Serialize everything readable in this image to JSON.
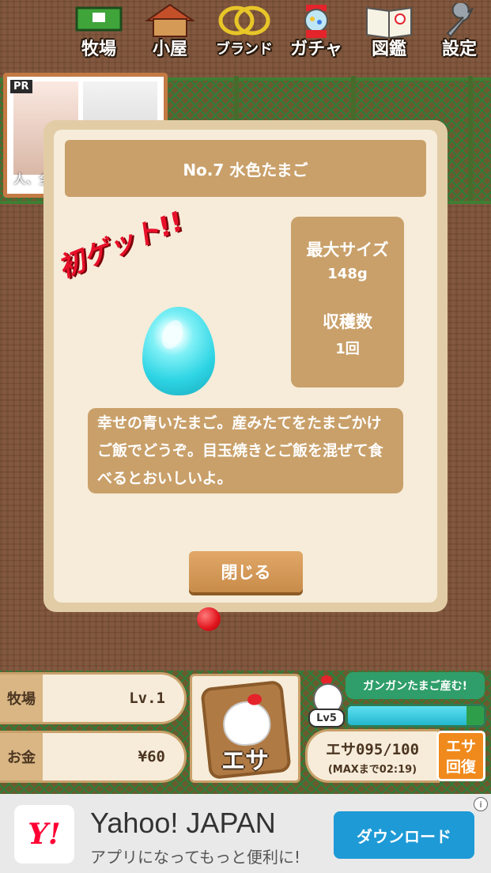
{
  "nav": [
    {
      "label": "牧場",
      "icon": "ranch-icon"
    },
    {
      "label": "小屋",
      "icon": "hut-icon"
    },
    {
      "label": "ブランド",
      "icon": "rings-icon"
    },
    {
      "label": "ガチャ",
      "icon": "gacha-machine-icon"
    },
    {
      "label": "図鑑",
      "icon": "book-icon"
    },
    {
      "label": "設定",
      "icon": "wrench-icon"
    }
  ],
  "pr_ad": {
    "badge": "PR",
    "caption": "人、全"
  },
  "modal": {
    "title": "No.7 水色たまご",
    "first_get": "初ゲット!!",
    "stats": {
      "max_size_label": "最大サイズ",
      "max_size_value": "148g",
      "harvest_label": "収穫数",
      "harvest_value": "1回"
    },
    "description": "幸せの青いたまご。産みたてをたまごかけご飯でどうぞ。目玉焼きとご飯を混ぜて食べるとおいしいよ。",
    "close_label": "閉じる",
    "egg_color": "#2dd4e4"
  },
  "status": {
    "ranch_label": "牧場",
    "ranch_value": "Lv.1",
    "money_label": "お金",
    "money_value": "¥60"
  },
  "feed_button": {
    "label": "エサ"
  },
  "chicken": {
    "speech": "ガンガンたまご産む!",
    "level": "Lv5",
    "gauge_fraction": 0.87
  },
  "esa": {
    "count": "エサ095/100",
    "timer": "(MAXまで02:19)",
    "recover_label_1": "エサ",
    "recover_label_2": "回復"
  },
  "ad": {
    "logo_text": "Y!",
    "title": "Yahoo! JAPAN",
    "subtitle": "アプリになってもっと便利に!",
    "cta": "ダウンロード",
    "info_glyph": "i"
  }
}
